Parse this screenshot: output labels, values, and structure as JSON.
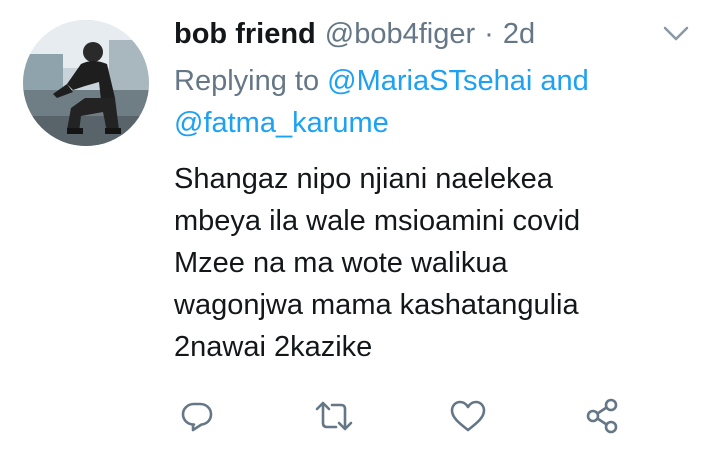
{
  "tweet": {
    "display_name": "bob friend",
    "handle": "@bob4figer",
    "separator": "·",
    "time": "2d",
    "reply": {
      "prefix": "Replying to",
      "mention_1": "@MariaSTsehai",
      "joiner": "and",
      "mention_2": "@fatma_karume"
    },
    "body_lines": [
      "Shangaz nipo njiani naelekea",
      "mbeya ila wale msioamini covid",
      "Mzee na ma wote walikua",
      "wagonjwa mama kashatangulia",
      "2nawai 2kazike"
    ]
  },
  "icons": {
    "caret": "chevron-down-icon",
    "reply": "reply-icon",
    "retweet": "retweet-icon",
    "like": "heart-icon",
    "share": "share-icon"
  },
  "colors": {
    "text": "#14171a",
    "secondary": "#657786",
    "link": "#1da1f2",
    "icon": "#657786"
  }
}
